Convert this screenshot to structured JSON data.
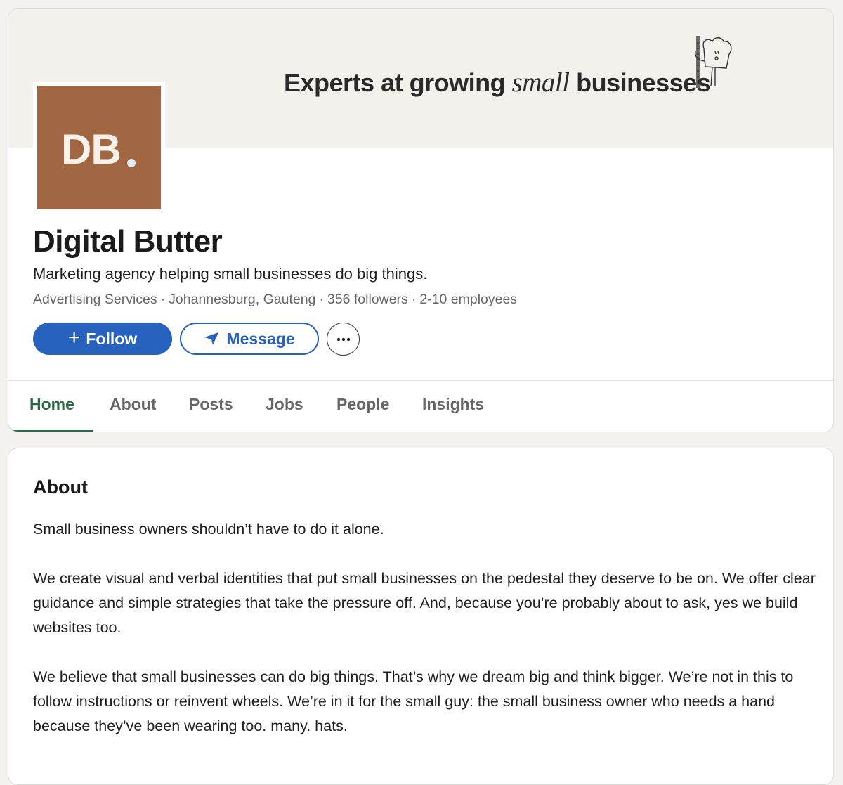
{
  "banner": {
    "text_before": "Experts at growing ",
    "text_italic": "small",
    "text_after": " businesses",
    "mascot_icon": "toast-mascot-icon",
    "background": "#f3f1ec"
  },
  "logo": {
    "initials": "DB",
    "background": "#a16642"
  },
  "company": {
    "name": "Digital Butter",
    "tagline": "Marketing agency helping small businesses do big things.",
    "meta": {
      "industry": "Advertising Services",
      "location": "Johannesburg, Gauteng",
      "followers": "356 followers",
      "employees": "2-10 employees",
      "separator": "·"
    }
  },
  "actions": {
    "follow_label": "Follow",
    "follow_icon": "plus-icon",
    "message_label": "Message",
    "message_icon": "send-icon",
    "more_icon": "more-icon",
    "more_glyph": "•••",
    "primary_color": "#2862bf"
  },
  "tabs": {
    "items": [
      {
        "label": "Home",
        "active": true
      },
      {
        "label": "About",
        "active": false
      },
      {
        "label": "Posts",
        "active": false
      },
      {
        "label": "Jobs",
        "active": false
      },
      {
        "label": "People",
        "active": false
      },
      {
        "label": "Insights",
        "active": false
      }
    ],
    "active_color": "#2b6b46"
  },
  "about": {
    "title": "About",
    "paragraphs": [
      "Small business owners shouldn’t have to do it alone.",
      "We create visual and verbal identities that put small businesses on the pedestal they deserve to be on. We offer clear guidance and simple strategies that take the pressure off. And, because you’re probably about to ask, yes we build websites too.",
      "We believe that small businesses can do big things. That’s why we dream big and think bigger. We’re not in this to follow instructions or reinvent wheels. We’re in it for the small guy: the small business owner who needs a hand because they’ve been wearing too. many. hats."
    ]
  }
}
